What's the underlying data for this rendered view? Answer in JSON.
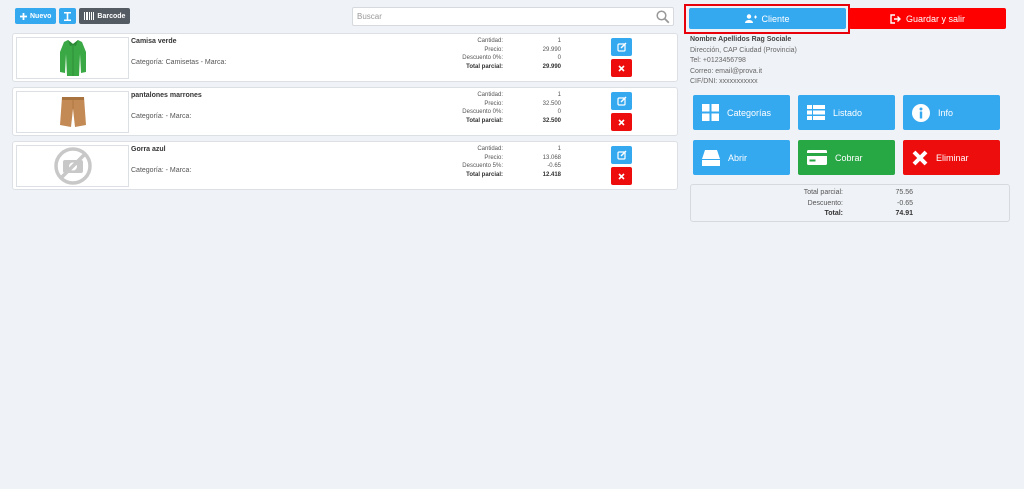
{
  "toolbar": {
    "new_label": "Nuevo",
    "barcode_label": "Barcode"
  },
  "search": {
    "placeholder": "Buscar"
  },
  "items": [
    {
      "name": "Camisa verde",
      "category": "Categoría: Camisetas - Marca:",
      "qty_label": "Cantidad:",
      "qty": "1",
      "price_label": "Precio:",
      "price": "29.990",
      "discount_label": "Descuento 0%:",
      "discount": "0",
      "subtotal_label": "Total parcial:",
      "subtotal": "29.990"
    },
    {
      "name": "pantalones marrones",
      "category": "Categoría: - Marca:",
      "qty_label": "Cantidad:",
      "qty": "1",
      "price_label": "Precio:",
      "price": "32.500",
      "discount_label": "Descuento 0%:",
      "discount": "0",
      "subtotal_label": "Total parcial:",
      "subtotal": "32.500"
    },
    {
      "name": "Gorra azul",
      "category": "Categoría: - Marca:",
      "qty_label": "Cantidad:",
      "qty": "1",
      "price_label": "Precio:",
      "price": "13.068",
      "discount_label": "Descuento 5%:",
      "discount": "-0.65",
      "subtotal_label": "Total parcial:",
      "subtotal": "12.418"
    }
  ],
  "header": {
    "client_label": "Cliente",
    "save_label": "Guardar y salir"
  },
  "customer": {
    "name": "Nombre Apellidos Rag Sociale",
    "address": "Dirección, CAP Ciudad (Provincia)",
    "phone": "Tel: +0123456798",
    "email": "Correo: email@prova.it",
    "vat": "CIF/DNI: xxxxxxxxxxx"
  },
  "actions": {
    "categories": "Categorías",
    "list": "Listado",
    "info": "Info",
    "open": "Abrir",
    "charge": "Cobrar",
    "delete": "Eliminar"
  },
  "totals": {
    "subtotal_label": "Total parcial:",
    "subtotal": "75.56",
    "discount_label": "Descuento:",
    "discount": "-0.65",
    "total_label": "Total:",
    "total": "74.91"
  },
  "colors": {
    "primary": "#35a9f0",
    "danger": "#ee0d0d",
    "success": "#28a745",
    "highlight": "#e8000a"
  }
}
